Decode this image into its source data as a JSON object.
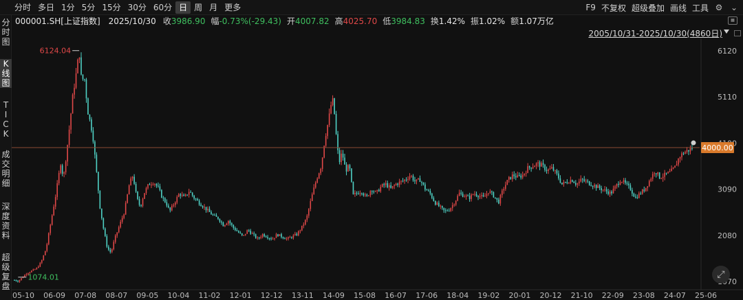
{
  "toolbar": {
    "periods": [
      {
        "label": "分时",
        "active": false
      },
      {
        "label": "多日",
        "active": false
      },
      {
        "label": "1分",
        "active": false
      },
      {
        "label": "5分",
        "active": false
      },
      {
        "label": "15分",
        "active": false
      },
      {
        "label": "30分",
        "active": false
      },
      {
        "label": "60分",
        "active": false
      },
      {
        "label": "日",
        "active": true
      },
      {
        "label": "周",
        "active": false
      },
      {
        "label": "月",
        "active": false
      },
      {
        "label": "更多",
        "active": false
      }
    ],
    "right": {
      "f9": "F9",
      "no_restore": "不复权",
      "overlay": "超级叠加",
      "draw_line": "画线",
      "tools": "工具"
    }
  },
  "sidebar": {
    "items": [
      {
        "label": "分时图",
        "active": false
      },
      {
        "label": "K线图",
        "active": true
      },
      {
        "label": "TICK",
        "active": false
      },
      {
        "label": "成交明细",
        "active": false
      },
      {
        "label": "深度资料",
        "active": false
      },
      {
        "label": "超级复盘",
        "active": false
      }
    ]
  },
  "info": {
    "code": "000001.SH[上证指数]",
    "date": "2025/10/30",
    "close_label": "收",
    "close": "3986.90",
    "change_label": "幅",
    "change": "-0.73%(-29.43)",
    "open_label": "开",
    "open": "4007.82",
    "high_label": "高",
    "high": "4025.70",
    "low_label": "低",
    "low": "3984.83",
    "turnover_label": "换",
    "turnover": "1.42%",
    "amplitude_label": "振",
    "amplitude": "1.02%",
    "amount_label": "额",
    "amount": "1.07万亿"
  },
  "date_range": "2005/10/31-2025/10/30(4860日)",
  "chart_data": {
    "type": "candlestick",
    "y_ticks": [
      "6120",
      "5110",
      "4100",
      "3090",
      "2080",
      "1070"
    ],
    "y_tick_values": [
      6120,
      5110,
      4100,
      3090,
      2080,
      1070
    ],
    "x_ticks": [
      "05-10",
      "06-09",
      "07-08",
      "08-07",
      "09-05",
      "10-04",
      "11-02",
      "12-01",
      "12-12",
      "13-11",
      "14-09",
      "15-08",
      "16-07",
      "17-06",
      "18-04",
      "19-02",
      "20-01",
      "20-12",
      "21-10",
      "22-09",
      "23-08",
      "24-07",
      "25-06"
    ],
    "max_label": "6124.04",
    "min_label": "1074.01",
    "price_line_label": "4000.00",
    "price_line_value": 4000,
    "colors": {
      "up": "#e04848",
      "down": "#4fd1c5",
      "price_line": "#8a4a32",
      "max": "#e04848",
      "min": "#3fbf5f"
    },
    "series": [
      [
        0,
        1100
      ],
      [
        3,
        1074
      ],
      [
        6,
        1150
      ],
      [
        10,
        1250
      ],
      [
        14,
        1300
      ],
      [
        18,
        1350
      ],
      [
        22,
        1500
      ],
      [
        26,
        1800
      ],
      [
        30,
        2400
      ],
      [
        34,
        3000
      ],
      [
        38,
        3700
      ],
      [
        40,
        3300
      ],
      [
        44,
        4200
      ],
      [
        48,
        5200
      ],
      [
        51,
        5700
      ],
      [
        53,
        6124
      ],
      [
        55,
        5400
      ],
      [
        57,
        5600
      ],
      [
        60,
        4800
      ],
      [
        64,
        4300
      ],
      [
        67,
        3500
      ],
      [
        70,
        2700
      ],
      [
        73,
        2200
      ],
      [
        76,
        1800
      ],
      [
        79,
        1700
      ],
      [
        82,
        2000
      ],
      [
        86,
        2300
      ],
      [
        90,
        2600
      ],
      [
        94,
        3200
      ],
      [
        97,
        3400
      ],
      [
        100,
        2900
      ],
      [
        103,
        2700
      ],
      [
        106,
        3000
      ],
      [
        110,
        3200
      ],
      [
        114,
        3250
      ],
      [
        118,
        3100
      ],
      [
        121,
        2900
      ],
      [
        124,
        2800
      ],
      [
        127,
        2600
      ],
      [
        131,
        2800
      ],
      [
        135,
        3000
      ],
      [
        139,
        2900
      ],
      [
        143,
        3050
      ],
      [
        147,
        2900
      ],
      [
        151,
        2800
      ],
      [
        155,
        2700
      ],
      [
        159,
        2600
      ],
      [
        163,
        2500
      ],
      [
        167,
        2450
      ],
      [
        171,
        2300
      ],
      [
        175,
        2400
      ],
      [
        179,
        2250
      ],
      [
        183,
        2150
      ],
      [
        187,
        2050
      ],
      [
        191,
        2200
      ],
      [
        195,
        2100
      ],
      [
        199,
        2000
      ],
      [
        203,
        2100
      ],
      [
        207,
        2050
      ],
      [
        211,
        2000
      ],
      [
        215,
        2100
      ],
      [
        219,
        2050
      ],
      [
        223,
        2000
      ],
      [
        227,
        2050
      ],
      [
        231,
        2100
      ],
      [
        235,
        2250
      ],
      [
        239,
        2450
      ],
      [
        243,
        2900
      ],
      [
        247,
        3300
      ],
      [
        251,
        3600
      ],
      [
        254,
        4200
      ],
      [
        257,
        4600
      ],
      [
        260,
        5100
      ],
      [
        262,
        4700
      ],
      [
        264,
        4000
      ],
      [
        266,
        3700
      ],
      [
        268,
        3900
      ],
      [
        271,
        3500
      ],
      [
        274,
        3600
      ],
      [
        277,
        2950
      ],
      [
        280,
        3000
      ],
      [
        284,
        3050
      ],
      [
        288,
        2900
      ],
      [
        292,
        3100
      ],
      [
        296,
        3000
      ],
      [
        300,
        3150
      ],
      [
        304,
        3200
      ],
      [
        308,
        3100
      ],
      [
        312,
        3200
      ],
      [
        316,
        3250
      ],
      [
        320,
        3300
      ],
      [
        324,
        3400
      ],
      [
        328,
        3250
      ],
      [
        332,
        3300
      ],
      [
        336,
        3100
      ],
      [
        340,
        3000
      ],
      [
        344,
        2800
      ],
      [
        348,
        2700
      ],
      [
        352,
        2600
      ],
      [
        356,
        2650
      ],
      [
        360,
        2800
      ],
      [
        364,
        3000
      ],
      [
        368,
        2950
      ],
      [
        372,
        2900
      ],
      [
        376,
        3000
      ],
      [
        380,
        2950
      ],
      [
        384,
        2900
      ],
      [
        388,
        3050
      ],
      [
        392,
        2950
      ],
      [
        396,
        2800
      ],
      [
        400,
        3100
      ],
      [
        404,
        3300
      ],
      [
        408,
        3400
      ],
      [
        412,
        3350
      ],
      [
        416,
        3400
      ],
      [
        420,
        3550
      ],
      [
        424,
        3600
      ],
      [
        428,
        3650
      ],
      [
        432,
        3600
      ],
      [
        436,
        3500
      ],
      [
        440,
        3550
      ],
      [
        444,
        3400
      ],
      [
        448,
        3200
      ],
      [
        452,
        3250
      ],
      [
        456,
        3300
      ],
      [
        460,
        3200
      ],
      [
        464,
        3300
      ],
      [
        468,
        3250
      ],
      [
        472,
        3200
      ],
      [
        476,
        3150
      ],
      [
        480,
        3100
      ],
      [
        484,
        3050
      ],
      [
        488,
        3000
      ],
      [
        492,
        3150
      ],
      [
        496,
        3300
      ],
      [
        500,
        3200
      ],
      [
        504,
        3100
      ],
      [
        508,
        2900
      ],
      [
        512,
        3000
      ],
      [
        516,
        3100
      ],
      [
        520,
        3300
      ],
      [
        524,
        3500
      ],
      [
        528,
        3350
      ],
      [
        532,
        3400
      ],
      [
        536,
        3450
      ],
      [
        540,
        3550
      ],
      [
        544,
        3800
      ],
      [
        548,
        3900
      ],
      [
        552,
        3950
      ],
      [
        555,
        4000
      ]
    ]
  }
}
